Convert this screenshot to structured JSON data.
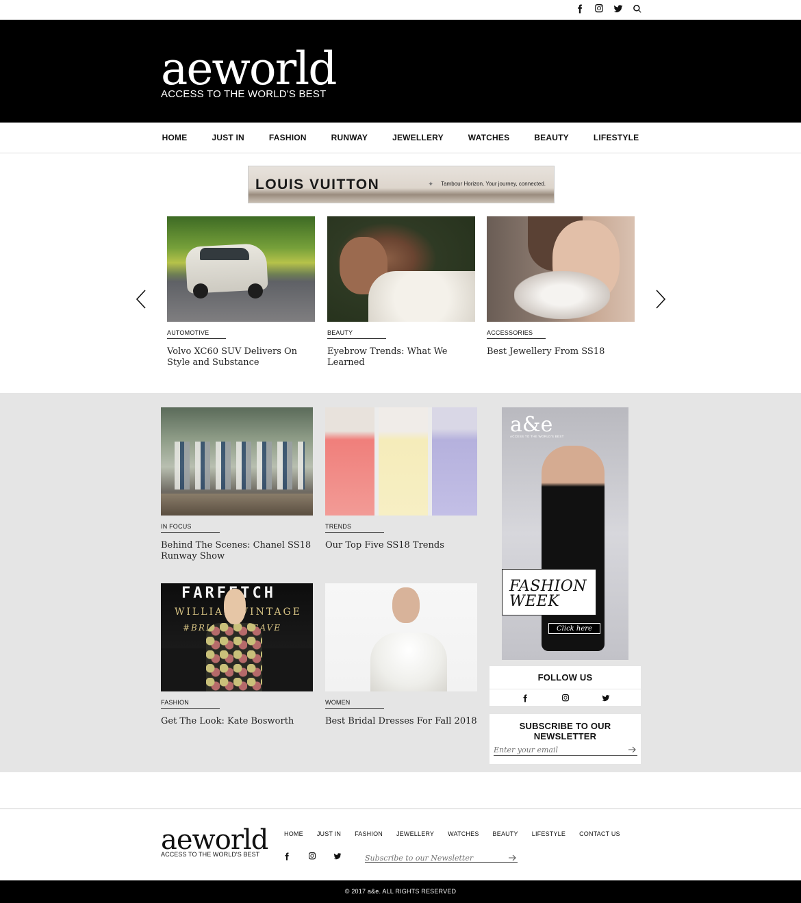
{
  "topbar": {
    "icons": [
      "facebook-icon",
      "instagram-icon",
      "twitter-icon",
      "search-icon"
    ]
  },
  "masthead": {
    "wordmark": "aeworld",
    "tagline": "ACCESS TO THE WORLD'S BEST"
  },
  "nav": {
    "items": [
      "HOME",
      "JUST IN",
      "FASHION",
      "RUNWAY",
      "JEWELLERY",
      "WATCHES",
      "BEAUTY",
      "LIFESTYLE"
    ]
  },
  "ad": {
    "brand": "LOUIS VUITTON",
    "tagline": "Tambour Horizon. Your journey, connected."
  },
  "carousel": {
    "cards": [
      {
        "category": "AUTOMOTIVE",
        "title": "Volvo XC60 SUV Delivers On Style and Substance"
      },
      {
        "category": "BEAUTY",
        "title": "Eyebrow Trends: What We Learned"
      },
      {
        "category": "ACCESSORIES",
        "title": "Best Jewellery From SS18"
      }
    ]
  },
  "grid": {
    "cards": [
      {
        "category": "IN FOCUS",
        "title": "Behind The Scenes: Chanel SS18 Runway Show"
      },
      {
        "category": "TRENDS",
        "title": "Our Top Five SS18 Trends"
      },
      {
        "category": "FASHION",
        "title": "Get The Look: Kate Bosworth"
      },
      {
        "category": "WOMEN",
        "title": "Best Bridal Dresses For Fall 2018"
      }
    ],
    "kate_image_text": {
      "line1": "FARFETCH",
      "line2": "WILLIAM VINTAGE",
      "line3": "#BRIGHTER SAVE"
    }
  },
  "sidebar": {
    "ad": {
      "logo": "a&e",
      "logo_sub": "ACCESS TO THE WORLD'S BEST",
      "headline_1": "FASHION",
      "headline_2": "WEEK",
      "cta": "Click here"
    },
    "follow": {
      "heading": "FOLLOW US",
      "icons": [
        "facebook-icon",
        "instagram-icon",
        "twitter-icon"
      ]
    },
    "newsletter": {
      "heading": "SUBSCRIBE TO OUR NEWSLETTER",
      "placeholder": "Enter your email"
    }
  },
  "footer": {
    "wordmark": "aeworld",
    "tagline": "ACCESS TO THE WORLD'S BEST",
    "nav": [
      "HOME",
      "JUST IN",
      "FASHION",
      "JEWELLERY",
      "WATCHES",
      "BEAUTY",
      "LIFESTYLE",
      "CONTACT US"
    ],
    "newsletter_placeholder": "Subscribe to our Newsletter",
    "copyright": "© 2017 a&e. ALL RIGHTS RESERVED"
  }
}
